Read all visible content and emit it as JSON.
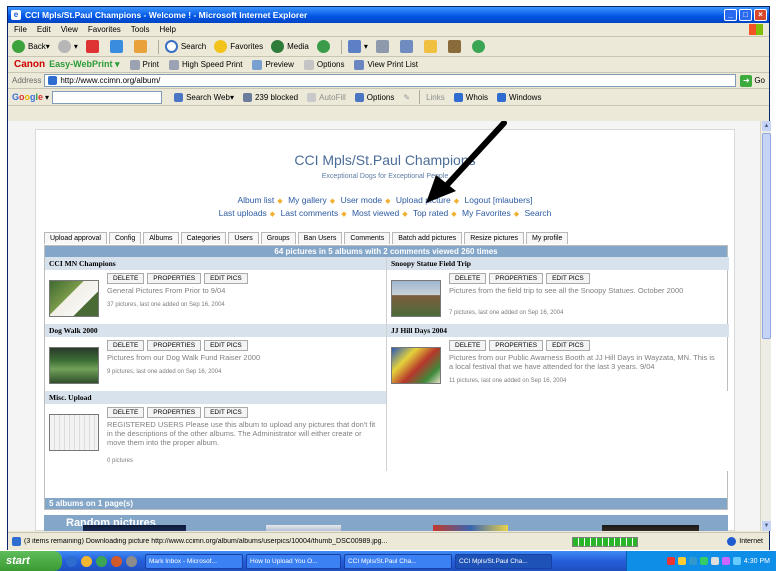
{
  "window": {
    "title": "CCI Mpls/St.Paul Champions - Welcome ! - Microsoft Internet Explorer"
  },
  "menu": [
    "File",
    "Edit",
    "View",
    "Favorites",
    "Tools",
    "Help"
  ],
  "toolbar": {
    "back": "Back",
    "search": "Search",
    "favorites": "Favorites",
    "media": "Media"
  },
  "canon": {
    "brand": "Canon",
    "product": "Easy-WebPrint",
    "print": "Print",
    "high_speed": "High Speed Print",
    "preview": "Preview",
    "options": "Options",
    "view_list": "View Print List"
  },
  "address": {
    "label": "Address",
    "url": "http://www.ccimn.org/album/",
    "go": "Go"
  },
  "google": {
    "logo": "Google",
    "search_web": "Search Web",
    "blocked": "239 blocked",
    "autofill": "AutoFill",
    "options": "Options",
    "links": "Links",
    "whois": "Whois",
    "windows": "Windows"
  },
  "page": {
    "site_title": "CCI Mpls/St.Paul Champions",
    "site_subtitle": "Exceptional Dogs for Exceptional People",
    "nav1": [
      "Album list",
      "My gallery",
      "User mode",
      "Upload picture",
      "Logout [mlaubers]"
    ],
    "nav2": [
      "Last uploads",
      "Last comments",
      "Most viewed",
      "Top rated",
      "My Favorites",
      "Search"
    ],
    "admin_tabs": [
      "Upload approval",
      "Config",
      "Albums",
      "Categories",
      "Users",
      "Groups",
      "Ban Users",
      "Comments",
      "Batch add pictures",
      "Resize pictures",
      "My profile"
    ],
    "stats": "64 pictures in 5 albums with 2 comments viewed 260 times",
    "album_buttons": [
      "DELETE",
      "PROPERTIES",
      "EDIT PICS"
    ],
    "albums": [
      {
        "name": "CCI MN Champions",
        "desc": "General Pictures From Prior to 9/04",
        "meta": "37 pictures, last one added on Sep 16, 2004"
      },
      {
        "name": "Snoopy Statue Field Trip",
        "desc": "Pictures from the field trip to see all the Snoopy Statues. October 2000",
        "meta": "7 pictures, last one added on Sep 16, 2004"
      },
      {
        "name": "Dog Walk 2000",
        "desc": "Pictures from our Dog Walk Fund Raiser 2000",
        "meta": "9 pictures, last one added on Sep 16, 2004"
      },
      {
        "name": "JJ Hill Days 2004",
        "desc": "Pictures from our Public Awarness Booth at JJ Hill Days in Wayzata, MN. This is a local festival that we have attended for the last 3 years. 9/04",
        "meta": "11 pictures, last one added on Sep 16, 2004"
      },
      {
        "name": "Misc. Upload",
        "desc": "REGISTERED USERS Please use this album to upload any pictures that don't fit in the descriptions of the other albums. The Administrator will either create or move them into the proper album.",
        "meta": "0 pictures"
      }
    ],
    "albums_footer": "5 albums on 1 page(s)",
    "random_title": "Random pictures"
  },
  "status": {
    "message": "(3 items remaining) Downloading picture http://www.ccimn.org/album/albums/userpics/10004/thumb_DSC00989.jpg...",
    "zone": "Internet",
    "progress": 1.0
  },
  "taskbar": {
    "start": "start",
    "tasks": [
      "Mark Inbox - Microsof...",
      "How to Upload You O...",
      "CCI Mpls/St.Paul Cha...",
      "CCI Mpls/St.Paul Cha..."
    ],
    "active_task": 3,
    "clock": "4:30 PM"
  },
  "colors": {
    "xp_blue": "#0054e3",
    "section_bar": "#84a6c8",
    "link": "#2c5aa0",
    "canon_red": "#cc0000"
  }
}
